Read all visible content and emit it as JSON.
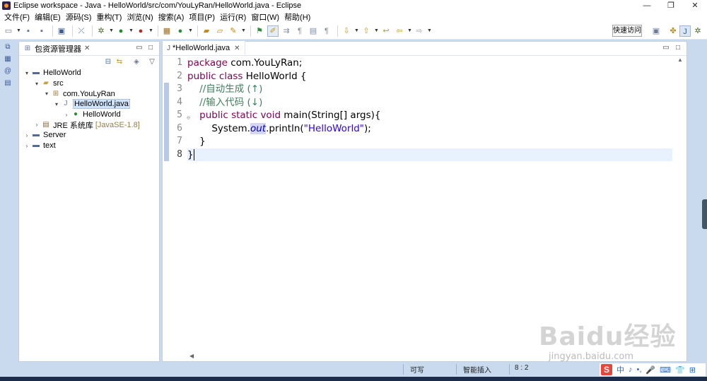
{
  "window": {
    "title": "Eclipse workspace - Java - HelloWorld/src/com/YouLyRan/HelloWorld.java - Eclipse",
    "minimize": "—",
    "restore": "❐",
    "close": "✕"
  },
  "menubar": {
    "items": [
      "文件(F)",
      "编辑(E)",
      "源码(S)",
      "重构(T)",
      "浏览(N)",
      "搜索(A)",
      "项目(P)",
      "运行(R)",
      "窗口(W)",
      "帮助(H)"
    ]
  },
  "toolbar": {
    "quick_access_label": "快速访问",
    "icons": [
      "new-icon",
      "save-icon",
      "save-all-icon",
      "print-icon",
      "skip-breakpoints-icon",
      "debug-icon",
      "run-icon",
      "external-tools-icon",
      "new-java-project-icon",
      "new-class-icon",
      "open-type-icon",
      "search-icon",
      "toggle-mark-occurrences-icon",
      "next-annotation-icon",
      "back-icon",
      "forward-icon"
    ],
    "perspectives": [
      "open-perspective-icon",
      "java-ee-perspective-icon",
      "java-perspective-icon",
      "debug-perspective-icon"
    ]
  },
  "package_explorer": {
    "tab_title": "包资源管理器",
    "tab_close": "✕",
    "tree": [
      {
        "label": "HelloWorld",
        "icon": "project-icon",
        "arrow": "▾",
        "level": 0
      },
      {
        "label": "src",
        "icon": "source-folder-icon",
        "arrow": "▾",
        "level": 1
      },
      {
        "label": "com.YouLyRan",
        "icon": "package-icon",
        "arrow": "▾",
        "level": 2
      },
      {
        "label": "HelloWorld.java",
        "icon": "java-file-icon",
        "arrow": "▾",
        "level": 3,
        "selected": true
      },
      {
        "label": "HelloWorld",
        "icon": "class-icon",
        "arrow": "›",
        "level": 4
      },
      {
        "label": "JRE 系统库",
        "suffix": "[JavaSE-1.8]",
        "icon": "library-icon",
        "arrow": "›",
        "level": 1
      },
      {
        "label": "Server",
        "icon": "project-icon",
        "arrow": "›",
        "level": 0
      },
      {
        "label": "text",
        "icon": "project-icon",
        "arrow": "›",
        "level": 0
      }
    ]
  },
  "editor": {
    "tab_title": "*HelloWorld.java",
    "tab_close": "✕",
    "line_numbers": [
      "1",
      "2",
      "3",
      "4",
      "5",
      "6",
      "7",
      "8"
    ],
    "lines": {
      "l1_kw": "package",
      "l1_rest": " com.YouLyRan;",
      "l2_kw": "public class",
      "l2_rest": " HelloWorld {",
      "l3": "    //自动生成 (↑)",
      "l4": "    //输入代码 (↓)",
      "l5_kw": "public static void",
      "l5_rest": " main(String[] args){",
      "l6_pre": "        System.",
      "l6_field": "out",
      "l6_mid": ".println(",
      "l6_str": "\"HelloWorld\"",
      "l6_end": ");",
      "l7": "    }",
      "l8": "}"
    }
  },
  "statusbar": {
    "writable": "可写",
    "insert_mode": "智能插入",
    "position": "8 : 2"
  },
  "ime": {
    "logo": "S",
    "items": [
      "中",
      "♪",
      "•,",
      "🎤",
      "⌨",
      "👕",
      "⊞"
    ]
  },
  "watermark": {
    "main": "Baidu经验",
    "sub": "jingyan.baidu.com"
  },
  "colors": {
    "keyword": "#7f0055",
    "comment": "#3f7f5f",
    "string": "#2a00ff",
    "field": "#0000c0",
    "current_line": "#e8f2fe",
    "chrome": "#c9d9ee"
  }
}
